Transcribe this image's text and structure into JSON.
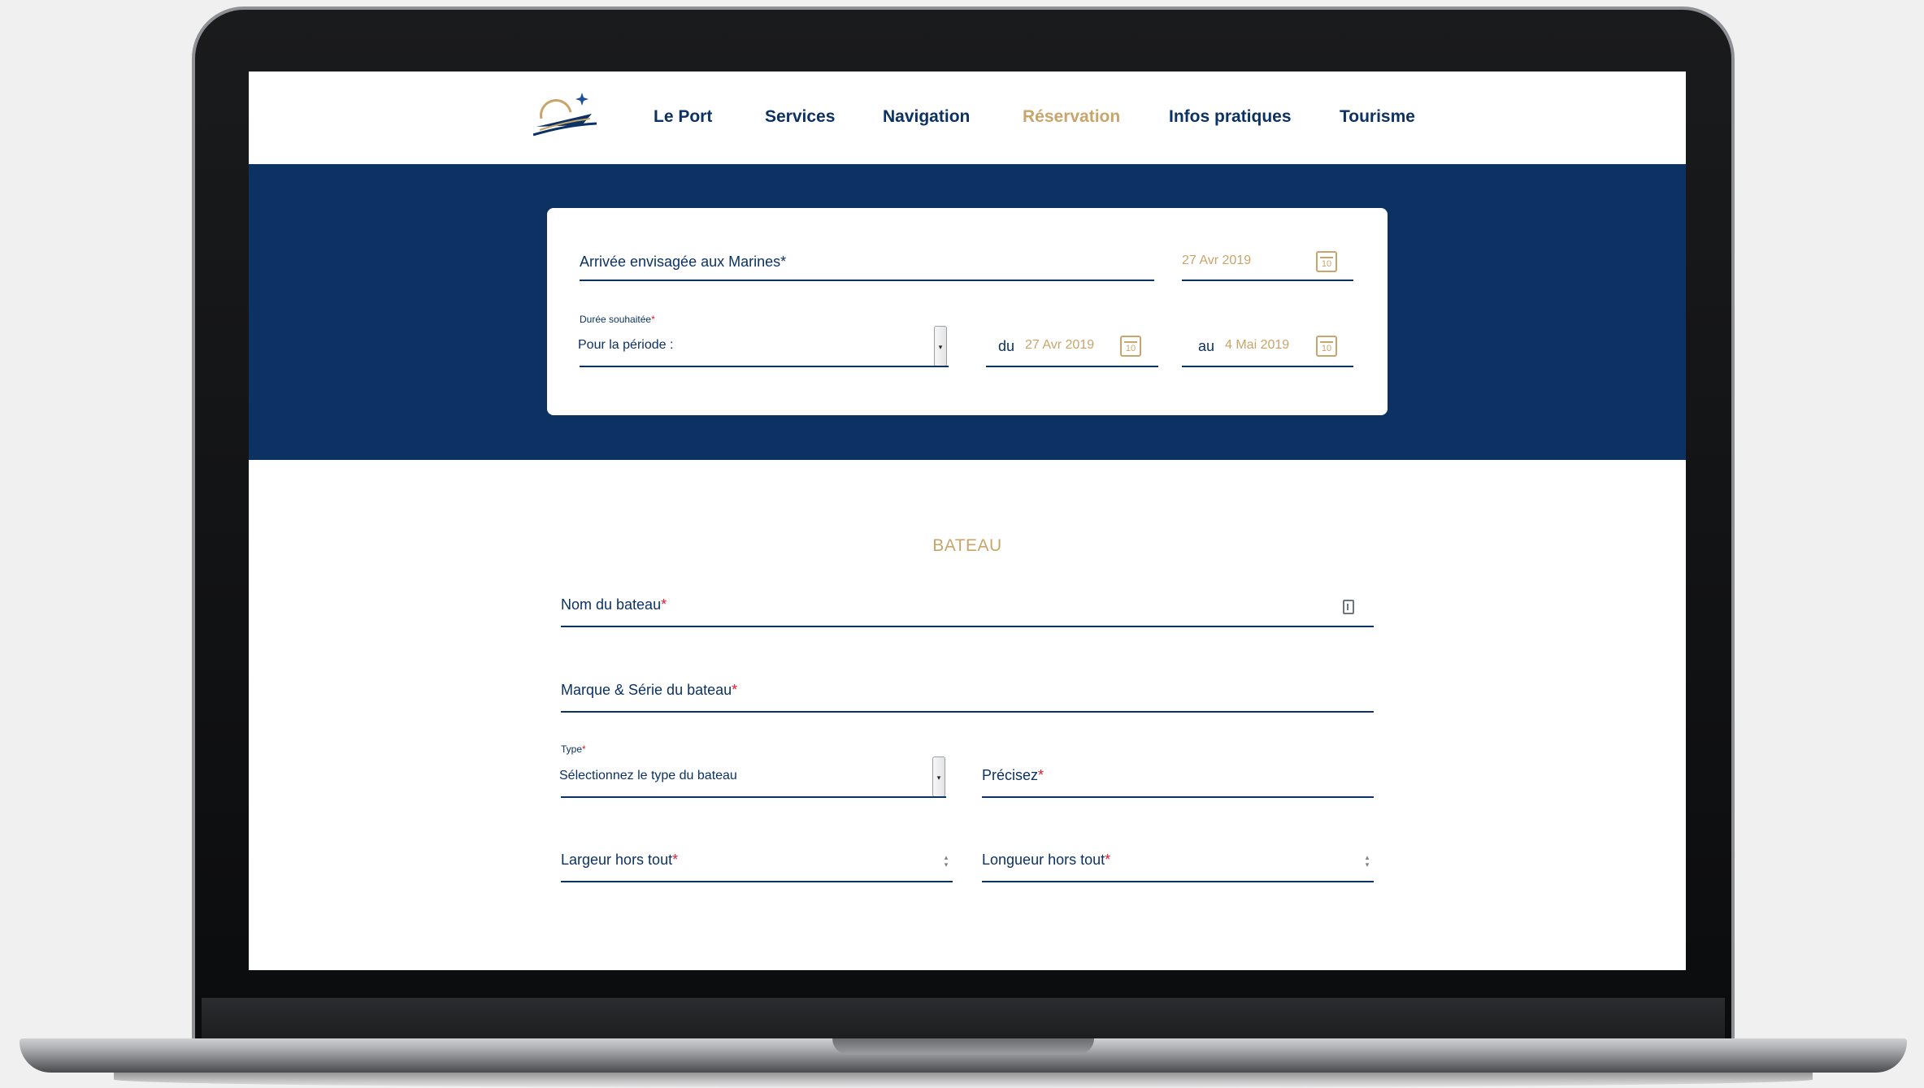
{
  "nav": {
    "items": [
      {
        "label": "Le Port"
      },
      {
        "label": "Services"
      },
      {
        "label": "Navigation"
      },
      {
        "label": "Réservation"
      },
      {
        "label": "Infos pratiques"
      },
      {
        "label": "Tourisme"
      }
    ],
    "active": "Réservation"
  },
  "arrival": {
    "label": "Arrivée envisagée aux Marines*",
    "date": "27 Avr 2019",
    "calendar_day": "10"
  },
  "duration": {
    "label": "Durée souhaitée",
    "required_mark": "*",
    "selected": "Pour la période :",
    "from_label": "du",
    "from_date": "27 Avr 2019",
    "to_label": "au",
    "to_date": "4 Mai 2019",
    "calendar_day": "10"
  },
  "boat": {
    "section_title": "BATEAU",
    "required_mark": "*",
    "name_label": "Nom du bateau",
    "brand_label": "Marque & Série du bateau",
    "type_label": "Type",
    "type_selected": "Sélectionnez le type du bateau",
    "specify_label": "Précisez",
    "width_label": "Largeur hors tout",
    "length_label": "Longueur hors tout"
  },
  "colors": {
    "navy": "#0b3263",
    "gold": "#c9a46b",
    "required": "#e21a2c"
  },
  "icons": {
    "select": "chevron-down-icon",
    "calendar": "calendar-icon",
    "spinner": "spinner-arrows-icon",
    "contact": "contact-card-icon"
  }
}
